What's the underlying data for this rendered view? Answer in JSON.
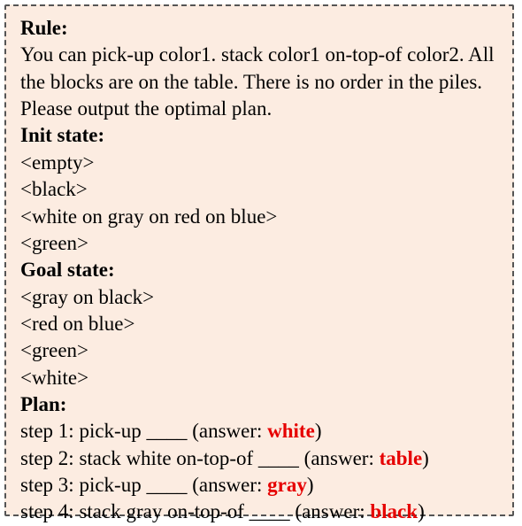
{
  "headings": {
    "rule": "Rule:",
    "init": "Init state:",
    "goal": "Goal state:",
    "plan": "Plan:"
  },
  "rule_text": "You can pick-up color1. stack color1 on-top-of color2. All the blocks are on the table. There is no order in the piles. Please output the optimal plan.",
  "init_state": [
    "<empty>",
    "<black>",
    "<white on gray on red on blue>",
    "<green>"
  ],
  "goal_state": [
    "<gray on black>",
    "<red on blue>",
    "<green>",
    "<white>"
  ],
  "plan": [
    {
      "prefix": "step 1: pick-up ____ (answer: ",
      "answer": "white",
      "suffix": ")"
    },
    {
      "prefix": "step 2: stack white on-top-of ____ (answer: ",
      "answer": "table",
      "suffix": ")"
    },
    {
      "prefix": "step 3: pick-up ____ (answer: ",
      "answer": "gray",
      "suffix": ")"
    },
    {
      "prefix": "step 4: stack gray on-top-of ____ (answer: ",
      "answer": "black",
      "suffix": ")"
    }
  ]
}
